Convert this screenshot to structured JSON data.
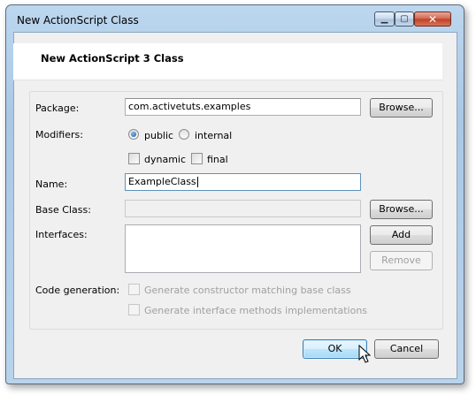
{
  "window": {
    "title": "New ActionScript Class"
  },
  "header": {
    "title": "New ActionScript 3 Class"
  },
  "form": {
    "package": {
      "label": "Package:",
      "value": "com.activetuts.examples",
      "browse": "Browse..."
    },
    "modifiers": {
      "label": "Modifiers:",
      "public": "public",
      "internal": "internal",
      "selected": "public",
      "dynamic": "dynamic",
      "final": "final"
    },
    "name": {
      "label": "Name:",
      "value": "ExampleClass"
    },
    "base_class": {
      "label": "Base Class:",
      "value": "",
      "browse": "Browse..."
    },
    "interfaces": {
      "label": "Interfaces:",
      "add": "Add",
      "remove": "Remove"
    },
    "code_generation": {
      "label": "Code generation:",
      "opt1": "Generate constructor matching base class",
      "opt2": "Generate interface methods implementations"
    }
  },
  "footer": {
    "ok": "OK",
    "cancel": "Cancel"
  },
  "icons": {
    "minimize": "minimize-icon",
    "maximize": "maximize-icon",
    "close": "close-icon",
    "cursor": "mouse-pointer-icon"
  }
}
